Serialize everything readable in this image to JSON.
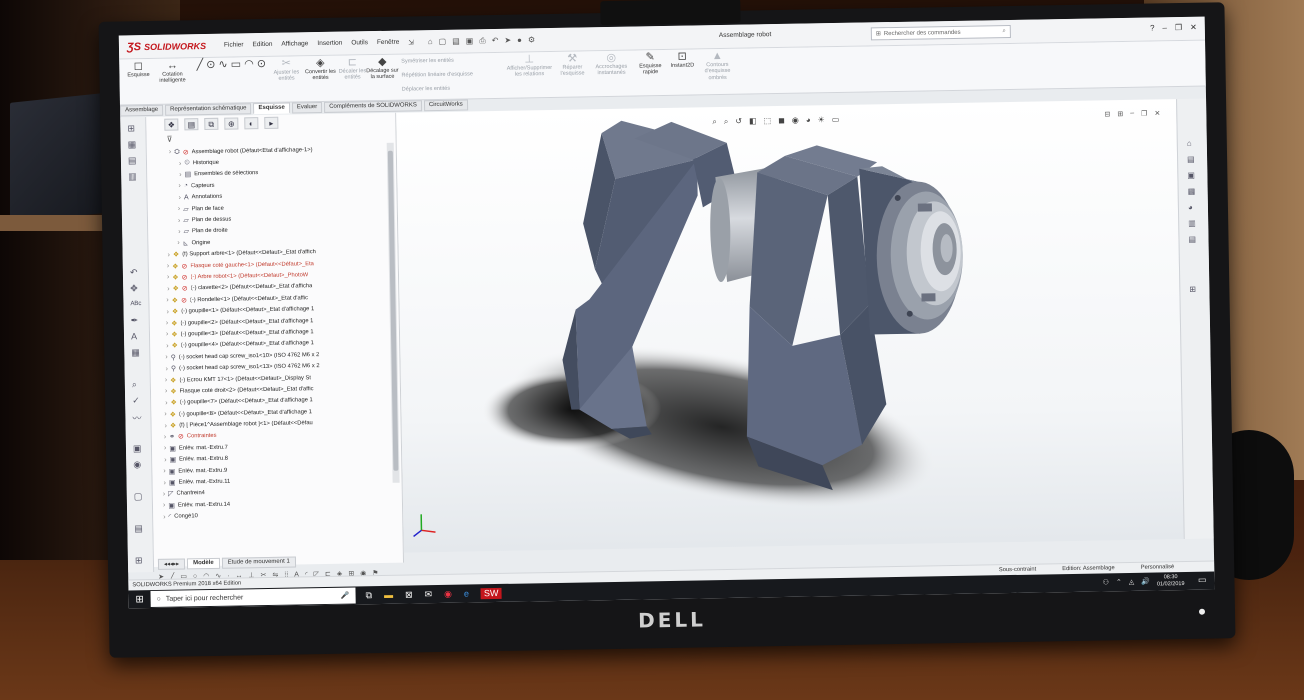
{
  "app": {
    "brand": "SOLIDWORKS",
    "document_title": "Assemblage robot",
    "search_placeholder": "Rechercher des commandes",
    "menus": [
      "Fichier",
      "Edition",
      "Affichage",
      "Insertion",
      "Outils",
      "Fenêtre"
    ]
  },
  "ribbon": {
    "buttons": [
      {
        "label": "Esquisse",
        "icon": "sketch-icon",
        "enabled": true
      },
      {
        "label": "Cotation intelligente",
        "icon": "smart-dimension-icon",
        "enabled": true
      },
      {
        "label": "Ajuster les entités",
        "icon": "trim-icon",
        "enabled": false
      },
      {
        "label": "Convertir les entités",
        "icon": "convert-icon",
        "enabled": true
      },
      {
        "label": "Décaler les entités",
        "icon": "offset-icon",
        "enabled": false
      },
      {
        "label": "Décalage sur la surface",
        "icon": "offset-surface-icon",
        "enabled": true
      },
      {
        "label": "Symétriser les entités",
        "icon": "mirror-icon",
        "enabled": false
      },
      {
        "label": "Répétition linéaire d'esquisse",
        "icon": "linear-pattern-icon",
        "enabled": false
      },
      {
        "label": "Déplacer les entités",
        "icon": "move-icon",
        "enabled": false
      },
      {
        "label": "Afficher/Supprimer les relations",
        "icon": "relations-icon",
        "enabled": false
      },
      {
        "label": "Réparer l'esquisse",
        "icon": "repair-icon",
        "enabled": false
      },
      {
        "label": "Accrochages instantanés",
        "icon": "snaps-icon",
        "enabled": false
      },
      {
        "label": "Esquisse rapide",
        "icon": "rapid-sketch-icon",
        "enabled": true
      },
      {
        "label": "Instant2D",
        "icon": "instant2d-icon",
        "enabled": true
      },
      {
        "label": "Contours d'esquisse ombrés",
        "icon": "shaded-contours-icon",
        "enabled": false
      }
    ]
  },
  "command_tabs": [
    "Assemblage",
    "Représentation schématique",
    "Esquisse",
    "Evaluer",
    "Compléments de SOLIDWORKS",
    "CircuitWorks"
  ],
  "active_tab": "Esquisse",
  "feature_tree": [
    {
      "label": "Assemblage robot  (Défaut<Etat d'affichage-1>)",
      "icon": "assembly-icon",
      "warn": true,
      "indent": 0
    },
    {
      "label": "Historique",
      "icon": "history-icon",
      "indent": 1
    },
    {
      "label": "Ensembles de sélections",
      "icon": "selection-sets-icon",
      "indent": 1
    },
    {
      "label": "Capteurs",
      "icon": "sensors-icon",
      "indent": 1
    },
    {
      "label": "Annotations",
      "icon": "annotations-icon",
      "indent": 1
    },
    {
      "label": "Plan de face",
      "icon": "plane-icon",
      "indent": 1
    },
    {
      "label": "Plan de dessus",
      "icon": "plane-icon",
      "indent": 1
    },
    {
      "label": "Plan de droite",
      "icon": "plane-icon",
      "indent": 1
    },
    {
      "label": "Origine",
      "icon": "origin-icon",
      "indent": 1
    },
    {
      "label": "(f) Support arbre<1> (Défaut<<Défaut>_Etat d'affich",
      "icon": "part-icon",
      "indent": 0
    },
    {
      "label": "Flasque coté gauche<1> (Défaut<<Défaut>_Eta",
      "icon": "part-icon",
      "warn": true,
      "red": true,
      "indent": 0
    },
    {
      "label": "(-) Arbre robot<1> (Défaut<<Défaut>_PhotoW",
      "icon": "part-icon",
      "warn": true,
      "red": true,
      "indent": 0
    },
    {
      "label": "(-) clavette<2> (Défaut<<Défaut>_Etat d'afficha",
      "icon": "part-icon",
      "warn": true,
      "indent": 0
    },
    {
      "label": "(-) Rondelle<1> (Défaut<<Défaut>_Etat d'affic",
      "icon": "part-icon",
      "warn": true,
      "indent": 0
    },
    {
      "label": "(-) goupille<1> (Défaut<<Défaut>_Etat d'affichage 1",
      "icon": "part-icon",
      "indent": 0
    },
    {
      "label": "(-) goupille<2> (Défaut<<Défaut>_Etat d'affichage 1",
      "icon": "part-icon",
      "indent": 0
    },
    {
      "label": "(-) goupille<3> (Défaut<<Défaut>_Etat d'affichage 1",
      "icon": "part-icon",
      "indent": 0
    },
    {
      "label": "(-) goupille<4> (Défaut<<Défaut>_Etat d'affichage 1",
      "icon": "part-icon",
      "indent": 0
    },
    {
      "label": "(-) socket head cap screw_iso1<10> (ISO 4762 M6 x 2",
      "icon": "screw-icon",
      "indent": 0
    },
    {
      "label": "(-) socket head cap screw_iso1<13> (ISO 4762 M6 x 2",
      "icon": "screw-icon",
      "indent": 0
    },
    {
      "label": "(-) Ecrou KMT 17<1> (Défaut<<Défaut>_Display St",
      "icon": "part-icon",
      "indent": 0
    },
    {
      "label": "Flasque coté droit<2> (Défaut<<Défaut>_Etat d'affic",
      "icon": "part-icon",
      "indent": 0
    },
    {
      "label": "(-) goupille<7> (Défaut<<Défaut>_Etat d'affichage 1",
      "icon": "part-icon",
      "indent": 0
    },
    {
      "label": "(-) goupille<8> (Défaut<<Défaut>_Etat d'affichage 1",
      "icon": "part-icon",
      "indent": 0
    },
    {
      "label": "(f) [ Pièce1^Assemblage robot ]<1> (Défaut<<Défau",
      "icon": "part-icon",
      "indent": 0
    },
    {
      "label": "Contraintes",
      "icon": "mates-icon",
      "warn": true,
      "red": true,
      "indent": 0
    },
    {
      "label": "Enlév. mat.-Extru.7",
      "icon": "cut-extrude-icon",
      "indent": 0
    },
    {
      "label": "Enlév. mat.-Extru.8",
      "icon": "cut-extrude-icon",
      "indent": 0
    },
    {
      "label": "Enlév. mat.-Extru.9",
      "icon": "cut-extrude-icon",
      "indent": 0
    },
    {
      "label": "Enlév. mat.-Extru.11",
      "icon": "cut-extrude-icon",
      "indent": 0
    },
    {
      "label": "Chanfrein4",
      "icon": "chamfer-icon",
      "indent": 0
    },
    {
      "label": "Enlév. mat.-Extru.14",
      "icon": "cut-extrude-icon",
      "indent": 0
    },
    {
      "label": "Congé10",
      "icon": "fillet-icon",
      "indent": 0
    }
  ],
  "bottom_tabs": [
    "Modèle",
    "Etude de mouvement 1"
  ],
  "status": {
    "left": "SOLIDWORKS Premium 2018 x64 Edition",
    "state": "Sous-contraint",
    "mode": "Edition: Assemblage",
    "custom": "Personnalisé"
  },
  "taskbar": {
    "search_placeholder": "Taper ici pour rechercher",
    "time": "08:30",
    "date": "01/02/2019"
  },
  "monitor_brand": "DELL",
  "colors": {
    "brand_red": "#c4161c",
    "part_steel": "#5f6b84",
    "part_grey": "#a7acb3"
  }
}
